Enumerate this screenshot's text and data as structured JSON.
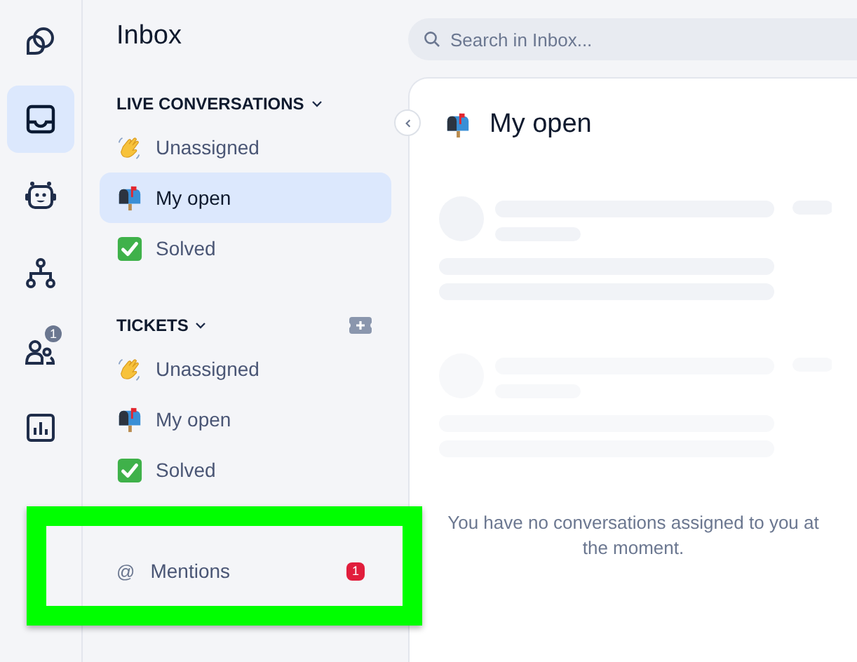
{
  "nav": [
    {
      "kind": "shapes",
      "selected": false
    },
    {
      "kind": "inbox",
      "selected": true
    },
    {
      "kind": "bot",
      "selected": false
    },
    {
      "kind": "hierarchy",
      "selected": false
    },
    {
      "kind": "people",
      "selected": false,
      "badge": "1"
    },
    {
      "kind": "chart",
      "selected": false
    }
  ],
  "sidebar": {
    "title": "Inbox",
    "sections": [
      {
        "label": "LIVE CONVERSATIONS",
        "expanded": true,
        "add_button": false,
        "items": [
          {
            "kind": "wave",
            "label": "Unassigned",
            "selected": false
          },
          {
            "kind": "mailbox",
            "label": "My open",
            "selected": true
          },
          {
            "kind": "check",
            "label": "Solved",
            "selected": false
          }
        ]
      },
      {
        "label": "TICKETS",
        "expanded": true,
        "add_button": true,
        "items": [
          {
            "kind": "wave",
            "label": "Unassigned",
            "selected": false
          },
          {
            "kind": "mailbox",
            "label": "My open",
            "selected": false
          },
          {
            "kind": "check",
            "label": "Solved",
            "selected": false
          }
        ]
      }
    ],
    "mentions": {
      "symbol": "@",
      "label": "Mentions",
      "badge": "1"
    }
  },
  "search": {
    "placeholder": "Search in Inbox..."
  },
  "main": {
    "title": "My open",
    "empty_message": "You have no conversations assigned to you at the moment."
  },
  "highlight": true
}
